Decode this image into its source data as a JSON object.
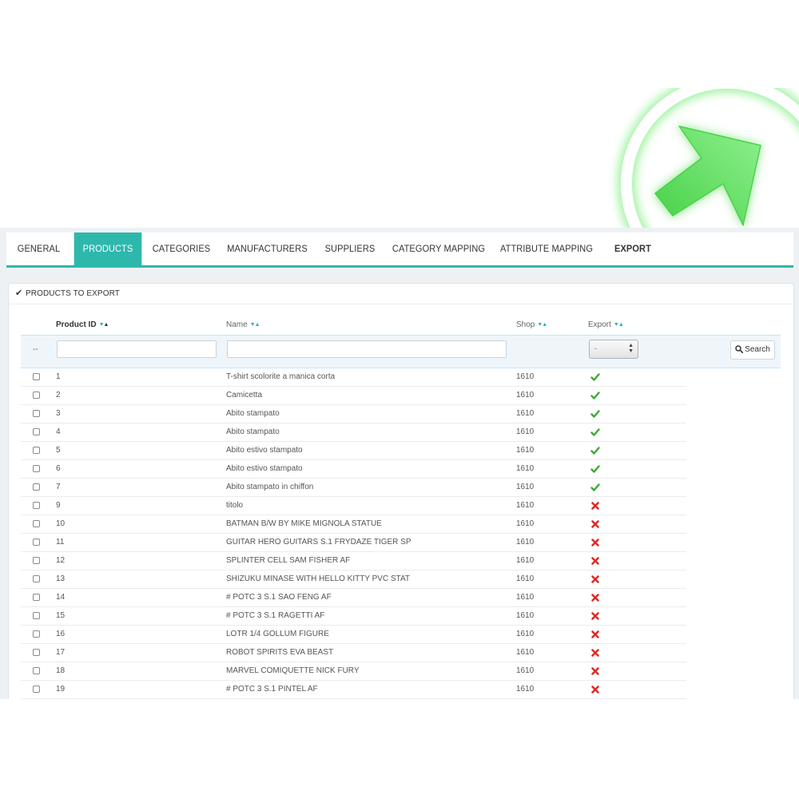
{
  "tabs": [
    {
      "label": "GENERAL",
      "active": false,
      "bold": false
    },
    {
      "label": "PRODUCTS",
      "active": true,
      "bold": false
    },
    {
      "label": "CATEGORIES",
      "active": false,
      "bold": false
    },
    {
      "label": "MANUFACTURERS",
      "active": false,
      "bold": false
    },
    {
      "label": "SUPPLIERS",
      "active": false,
      "bold": false
    },
    {
      "label": "CATEGORY MAPPING",
      "active": false,
      "bold": false
    },
    {
      "label": "ATTRIBUTE MAPPING",
      "active": false,
      "bold": false
    },
    {
      "label": "EXPORT",
      "active": false,
      "bold": true
    }
  ],
  "panel": {
    "title": "PRODUCTS TO EXPORT"
  },
  "table": {
    "columns": {
      "product_id": "Product ID",
      "name": "Name",
      "shop": "Shop",
      "export": "Export"
    },
    "filter": {
      "dash": "--",
      "export_value": "-",
      "search_label": "Search"
    },
    "rows": [
      {
        "id": "1",
        "name": "T-shirt scolorite a manica corta",
        "shop": "1610",
        "export": "yes"
      },
      {
        "id": "2",
        "name": "Camicetta",
        "shop": "1610",
        "export": "yes"
      },
      {
        "id": "3",
        "name": "Abito stampato",
        "shop": "1610",
        "export": "yes"
      },
      {
        "id": "4",
        "name": "Abito stampato",
        "shop": "1610",
        "export": "yes"
      },
      {
        "id": "5",
        "name": "Abito estivo stampato",
        "shop": "1610",
        "export": "yes"
      },
      {
        "id": "6",
        "name": "Abito estivo stampato",
        "shop": "1610",
        "export": "yes"
      },
      {
        "id": "7",
        "name": "Abito stampato in chiffon",
        "shop": "1610",
        "export": "yes"
      },
      {
        "id": "9",
        "name": "titolo",
        "shop": "1610",
        "export": "no"
      },
      {
        "id": "10",
        "name": "BATMAN B/W BY MIKE MIGNOLA STATUE",
        "shop": "1610",
        "export": "no"
      },
      {
        "id": "11",
        "name": "GUITAR HERO GUITARS S.1 FRYDAZE TIGER SP",
        "shop": "1610",
        "export": "no"
      },
      {
        "id": "12",
        "name": "SPLINTER CELL SAM FISHER AF",
        "shop": "1610",
        "export": "no"
      },
      {
        "id": "13",
        "name": "SHIZUKU MINASE WITH HELLO KITTY PVC STAT",
        "shop": "1610",
        "export": "no"
      },
      {
        "id": "14",
        "name": "# POTC 3 S.1 SAO FENG AF",
        "shop": "1610",
        "export": "no"
      },
      {
        "id": "15",
        "name": "# POTC 3 S.1 RAGETTI AF",
        "shop": "1610",
        "export": "no"
      },
      {
        "id": "16",
        "name": "LOTR 1/4 GOLLUM FIGURE",
        "shop": "1610",
        "export": "no"
      },
      {
        "id": "17",
        "name": "ROBOT SPIRITS EVA BEAST",
        "shop": "1610",
        "export": "no"
      },
      {
        "id": "18",
        "name": "MARVEL COMIQUETTE NICK FURY",
        "shop": "1610",
        "export": "no"
      },
      {
        "id": "19",
        "name": "# POTC 3 S.1 PINTEL AF",
        "shop": "1610",
        "export": "no"
      }
    ]
  },
  "colors": {
    "accent": "#2eb8ac",
    "check": "#3aaa35",
    "cross": "#e02b27",
    "logo_green": "#4ddc4d"
  },
  "icons": {
    "logo": "green-arrow-logo-icon",
    "panel": "checkmark-icon",
    "sort": "sort-arrows-icon",
    "search": "magnifier-icon",
    "export_yes": "green-check-icon",
    "export_no": "red-cross-icon"
  }
}
